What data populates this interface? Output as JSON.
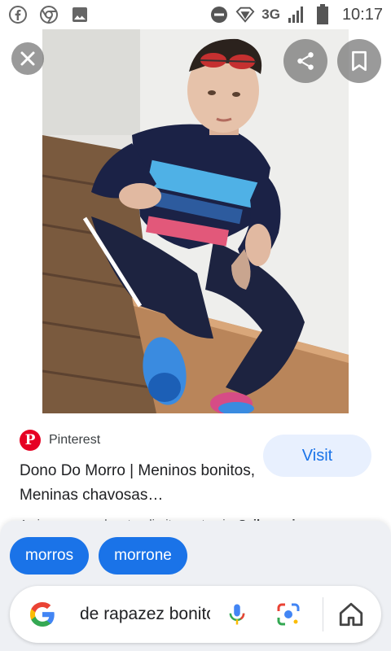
{
  "status_bar": {
    "network": "3G",
    "time": "10:17"
  },
  "result": {
    "source": "Pinterest",
    "title": "Dono Do Morro | Meninos bonitos, Meninas chavosas…",
    "visit_label": "Visit",
    "rights_text": "As imagens podem ter direitos autorais.",
    "learn_more_label": "Saiba mais"
  },
  "related_chips": [
    "morros",
    "morrone"
  ],
  "search": {
    "query": "de rapazez  bonitos"
  },
  "colors": {
    "accent": "#1a73e8",
    "pinterest": "#e60023",
    "visit_bg": "#e8f0fe"
  },
  "icons": [
    "facebook-icon",
    "chrome-icon",
    "gallery-icon",
    "dnd-icon",
    "data-saver-icon",
    "signal-icon",
    "battery-icon",
    "close-icon",
    "share-icon",
    "bookmark-icon",
    "google-logo",
    "mic-icon",
    "lens-icon",
    "home-icon"
  ]
}
